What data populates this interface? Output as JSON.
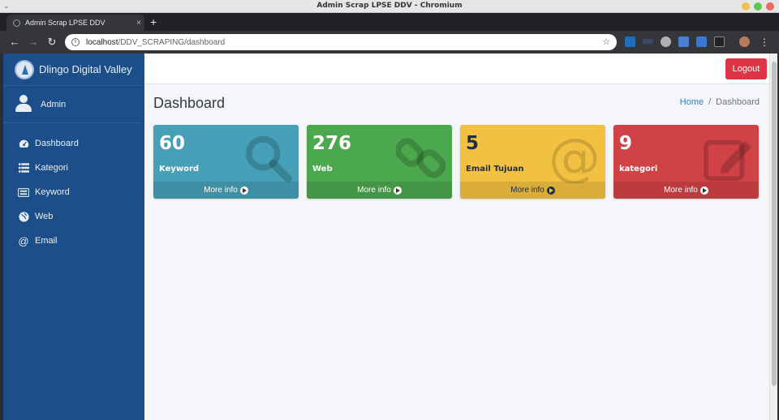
{
  "window": {
    "title": "Admin Scrap LPSE DDV - Chromium"
  },
  "browser": {
    "tab_title": "Admin Scrap LPSE DDV",
    "tab_close": "×",
    "new_tab": "+",
    "url_host": "localhost",
    "url_path": "/DDV_SCRAPING/dashboard"
  },
  "sidebar": {
    "brand": "Dlingo Digital Valley",
    "user": "Admin",
    "items": [
      {
        "label": "Dashboard",
        "icon": "dashboard-icon"
      },
      {
        "label": "Kategori",
        "icon": "list-icon"
      },
      {
        "label": "Keyword",
        "icon": "keyboard-icon"
      },
      {
        "label": "Web",
        "icon": "globe-icon"
      },
      {
        "label": "Email",
        "icon": "at-icon"
      }
    ]
  },
  "navbar": {
    "logout": "Logout"
  },
  "header": {
    "title": "Dashboard",
    "breadcrumb_home": "Home",
    "breadcrumb_sep": "/",
    "breadcrumb_current": "Dashboard"
  },
  "cards": [
    {
      "value": "60",
      "label": "Keyword",
      "footer": "More info",
      "icon": "search-icon",
      "color": "#46a0b7"
    },
    {
      "value": "276",
      "label": "Web",
      "footer": "More info",
      "icon": "link-icon",
      "color": "#4ca84e"
    },
    {
      "value": "5",
      "label": "Email Tujuan",
      "footer": "More info",
      "icon": "at-icon",
      "color": "#f3c142"
    },
    {
      "value": "9",
      "label": "kategori",
      "footer": "More info",
      "icon": "edit-icon",
      "color": "#d14246"
    }
  ]
}
